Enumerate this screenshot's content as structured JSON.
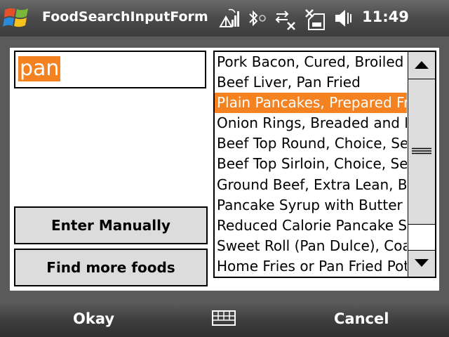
{
  "titlebar": {
    "app_title": "FoodSearchInputForm",
    "clock": "11:49",
    "icons": [
      "windows-start-icon",
      "antenna-signal-icon",
      "bluetooth-icon",
      "sync-off-icon",
      "no-sim-icon",
      "speaker-icon"
    ]
  },
  "search": {
    "value": "pan"
  },
  "buttons": {
    "enter_manually": "Enter Manually",
    "find_more_foods": "Find more foods"
  },
  "results": {
    "items": [
      "Pork Bacon, Cured, Broiled",
      "Beef Liver, Pan Fried",
      "Plain Pancakes, Prepared From",
      "Onion Rings, Breaded and Fried",
      "Beef Top Round, Choice, Separable",
      "Beef Top Sirloin, Choice, Separable",
      "Ground Beef, Extra Lean, Broiled",
      "Pancake Syrup with Butter",
      "Reduced Calorie Pancake Syrup",
      "Sweet Roll (Pan Dulce), Coated",
      "Home Fries or Pan Fried Potatoes"
    ],
    "selected_index": 2
  },
  "softkeys": {
    "left": "Okay",
    "right": "Cancel"
  },
  "colors": {
    "accent": "#f58220",
    "bar_dark": "#3c3c3c",
    "frame_gray": "#5a5a5a",
    "button_gray": "#dcdcdc"
  }
}
